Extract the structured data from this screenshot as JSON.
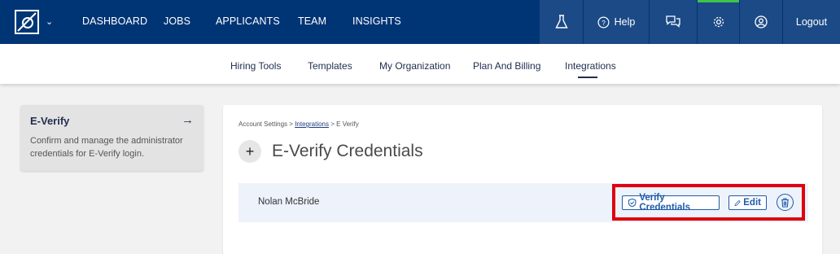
{
  "topnav": {
    "items": [
      "DASHBOARD",
      "JOBS",
      "APPLICANTS",
      "TEAM",
      "INSIGHTS"
    ],
    "help_label": "Help",
    "logout_label": "Logout",
    "icons": [
      "flask-icon",
      "chat-icon",
      "gear-icon",
      "user-icon"
    ]
  },
  "subnav": {
    "items": [
      "Hiring Tools",
      "Templates",
      "My Organization",
      "Plan And Billing",
      "Integrations"
    ],
    "active": "Integrations"
  },
  "left_card": {
    "title": "E-Verify",
    "description": "Confirm and manage the administrator credentials for E-Verify login."
  },
  "breadcrumb": {
    "root": "Account Settings",
    "sep": ">",
    "link": "Integrations",
    "current": "E Verify"
  },
  "page": {
    "title": "E-Verify Credentials",
    "plus_symbol": "+"
  },
  "credential": {
    "name": "Nolan McBride",
    "verify_label": "Verify Credentials",
    "edit_label": "Edit"
  },
  "colors": {
    "nav_bg": "#003575",
    "nav_right_bg": "#1b4a86",
    "accent": "#1f5ca8",
    "active_indicator": "#3fc34a",
    "highlight": "#e0000f"
  }
}
